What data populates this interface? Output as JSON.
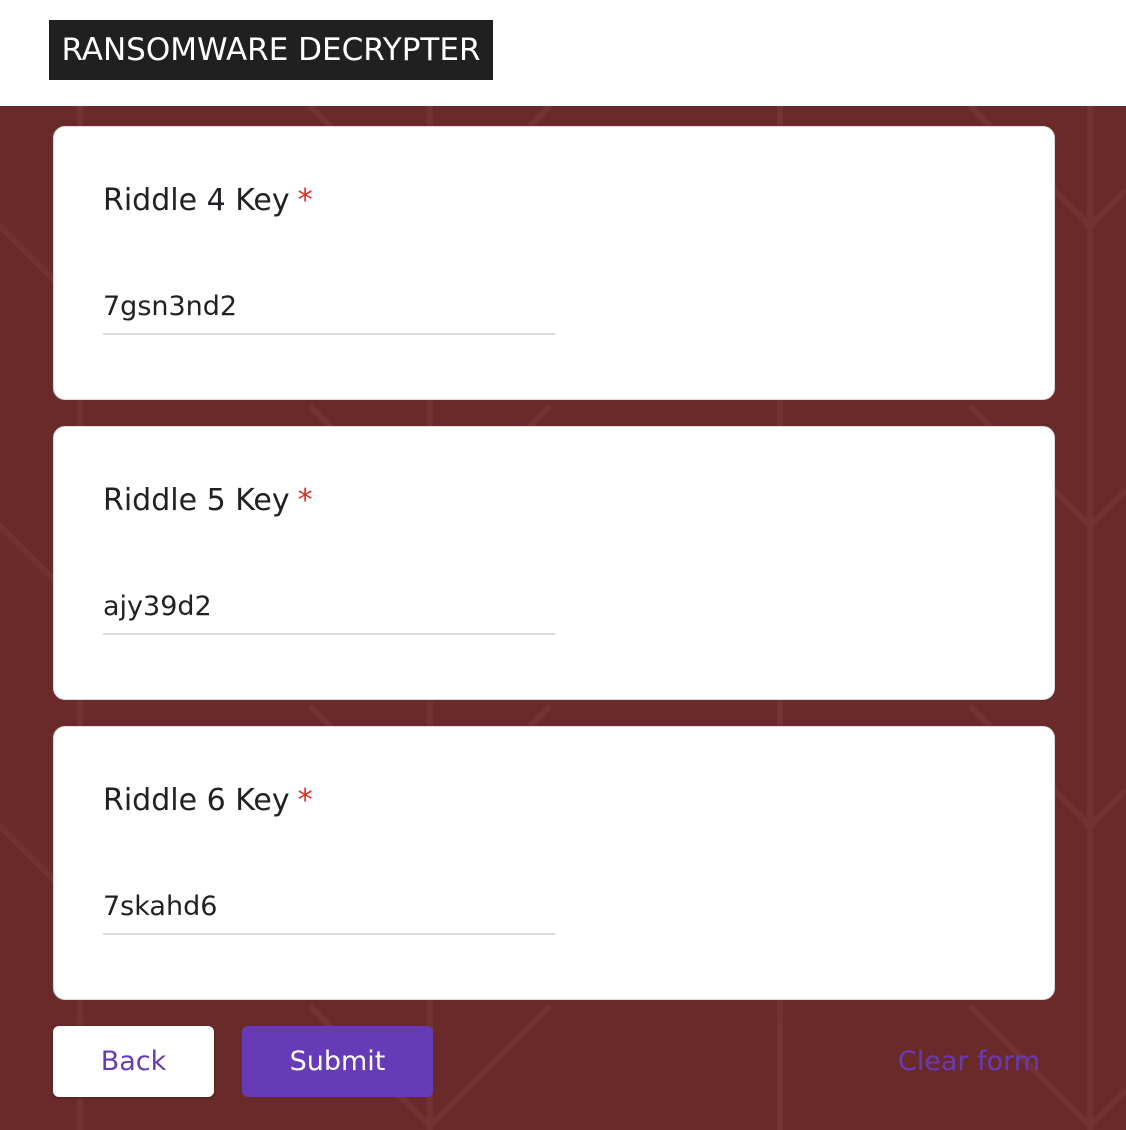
{
  "header": {
    "title": "RANSOMWARE DECRYPTER"
  },
  "colors": {
    "accent": "#673ab7",
    "background": "#6a2a2a",
    "required": "#d93025"
  },
  "questions": [
    {
      "label": "Riddle 4 Key",
      "required_marker": "*",
      "value": "7gsn3nd2"
    },
    {
      "label": "Riddle 5 Key",
      "required_marker": "*",
      "value": "ajy39d2"
    },
    {
      "label": "Riddle 6 Key",
      "required_marker": "*",
      "value": "7skahd6"
    }
  ],
  "actions": {
    "back_label": "Back",
    "submit_label": "Submit",
    "clear_label": "Clear form"
  }
}
